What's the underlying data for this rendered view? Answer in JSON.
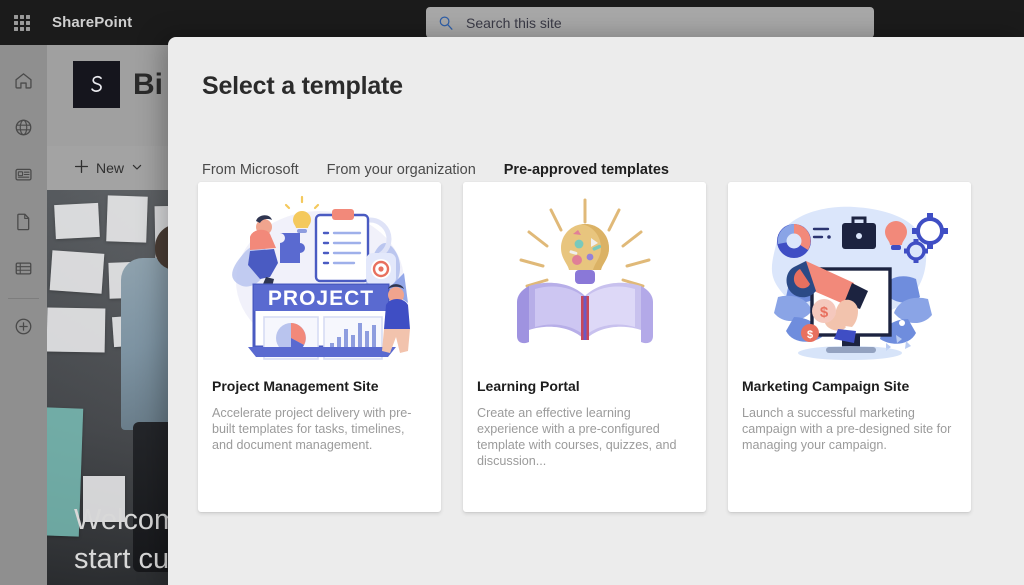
{
  "suite": {
    "app_launcher_icon": "waffle-grid-icon",
    "brand": "SharePoint",
    "search": {
      "icon": "search-icon",
      "placeholder": "Search this site",
      "value": ""
    }
  },
  "rail": {
    "items": [
      {
        "icon": "home-icon",
        "name": "home"
      },
      {
        "icon": "globe-icon",
        "name": "my-sites"
      },
      {
        "icon": "news-icon",
        "name": "news"
      },
      {
        "icon": "document-icon",
        "name": "files"
      },
      {
        "icon": "lists-icon",
        "name": "lists"
      },
      {
        "icon": "plus-circle-icon",
        "name": "create"
      }
    ]
  },
  "site": {
    "logo_glyph": "S",
    "title": "Bi",
    "command_bar": {
      "new_label": "New",
      "new_icon": "plus-icon",
      "chevron_icon": "chevron-down-icon"
    },
    "hero": {
      "line1": "Welcom",
      "line2": "start cu"
    }
  },
  "modal": {
    "title": "Select a template",
    "tabs": [
      {
        "label": "From Microsoft",
        "active": false
      },
      {
        "label": "From your organization",
        "active": false
      },
      {
        "label": "Pre-approved templates",
        "active": true
      }
    ],
    "accent_color": "#4a9ddd",
    "cards": [
      {
        "art": "project-management-illustration",
        "title": "Project Management Site",
        "description": "Accelerate project delivery with pre-built templates for tasks, timelines, and document management."
      },
      {
        "art": "learning-portal-illustration",
        "title": "Learning Portal",
        "description": "Create an effective learning experience with a pre-configured template with courses, quizzes, and discussion..."
      },
      {
        "art": "marketing-campaign-illustration",
        "title": "Marketing Campaign Site",
        "description": "Launch a successful marketing campaign with a pre-designed site for managing your campaign."
      }
    ]
  }
}
